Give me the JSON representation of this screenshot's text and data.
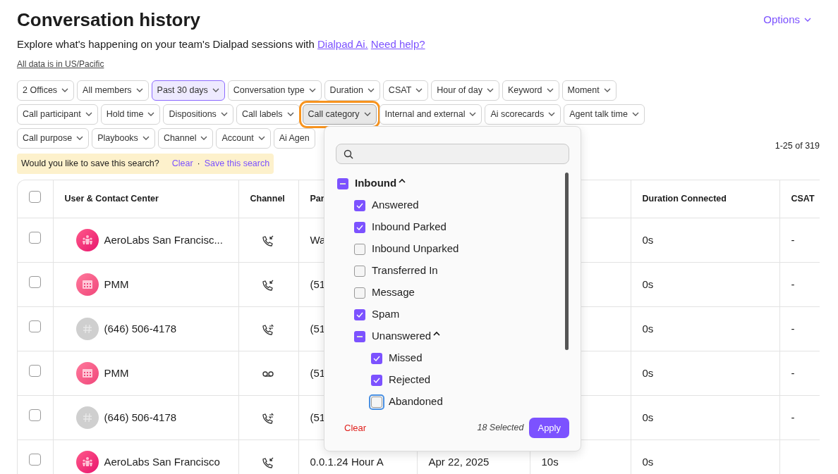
{
  "header": {
    "title": "Conversation history",
    "subtitle": "Explore what's happening on your team's Dialpad sessions with",
    "links": [
      "Dialpad Ai.",
      "Need help?"
    ],
    "timezone_note": "All data is in US/Pacific",
    "options": "Options"
  },
  "filter_rows": [
    [
      {
        "label": "2 Offices",
        "active": false,
        "open": false
      },
      {
        "label": "All members",
        "active": false,
        "open": false
      },
      {
        "label": "Past 30 days",
        "active": true,
        "open": false
      },
      {
        "label": "Conversation type",
        "active": false,
        "open": false
      },
      {
        "label": "Duration",
        "active": false,
        "open": false
      },
      {
        "label": "CSAT",
        "active": false,
        "open": false
      },
      {
        "label": "Hour of day",
        "active": false,
        "open": false
      },
      {
        "label": "Keyword",
        "active": false,
        "open": false
      },
      {
        "label": "Moment",
        "active": false,
        "open": false
      }
    ],
    [
      {
        "label": "Call participant",
        "active": false,
        "open": false
      },
      {
        "label": "Hold time",
        "active": false,
        "open": false
      },
      {
        "label": "Dispositions",
        "active": false,
        "open": false
      },
      {
        "label": "Call labels",
        "active": false,
        "open": false
      },
      {
        "label": "Call category",
        "active": false,
        "open": true
      },
      {
        "label": "Internal and external",
        "active": false,
        "open": false
      },
      {
        "label": "Ai scorecards",
        "active": false,
        "open": false
      },
      {
        "label": "Agent talk time",
        "active": false,
        "open": false
      }
    ],
    [
      {
        "label": "Call purpose",
        "active": false,
        "open": false
      },
      {
        "label": "Playbooks",
        "active": false,
        "open": false
      },
      {
        "label": "Channel",
        "active": false,
        "open": false
      },
      {
        "label": "Account",
        "active": false,
        "open": false
      },
      {
        "label": "Ai Agen",
        "active": false,
        "open": false
      }
    ]
  ],
  "save_prompt": {
    "text": "Would you like to save this search?",
    "actions": [
      "Clear",
      "Save this search"
    ],
    "separator": "·"
  },
  "pagination": "1-25 of 319",
  "table": {
    "select_all": {
      "checked": false
    },
    "columns": [
      "User & Contact Center",
      "Channel",
      "Par",
      "Duration Connected",
      "CSAT"
    ],
    "rows": [
      {
        "checked": false,
        "avatar": {
          "kind": "group"
        },
        "name": "AeroLabs San Francisc...",
        "channel": {
          "kind": "incoming"
        },
        "column_3": "Wa",
        "duration_connected": "0s",
        "csat": "-"
      },
      {
        "checked": false,
        "avatar": {
          "kind": "calendar"
        },
        "name": "PMM",
        "channel": {
          "kind": "incoming"
        },
        "column_3": "(51",
        "duration_connected": "0s",
        "csat": "-"
      },
      {
        "checked": false,
        "avatar": {
          "kind": "number"
        },
        "name": "(646) 506-4178",
        "channel": {
          "kind": "transfer"
        },
        "column_3": "(51",
        "duration_connected": "0s",
        "csat": "-"
      },
      {
        "checked": false,
        "avatar": {
          "kind": "calendar"
        },
        "name": "PMM",
        "channel": {
          "kind": "voicemail"
        },
        "column_3": "(51",
        "duration_connected": "0s",
        "csat": "-"
      },
      {
        "checked": false,
        "avatar": {
          "kind": "number"
        },
        "name": "(646) 506-4178",
        "channel": {
          "kind": "transfer"
        },
        "column_3": "(51",
        "duration_connected": "0s",
        "csat": "-"
      },
      {
        "checked": false,
        "avatar": {
          "kind": "group"
        },
        "name": "AeroLabs San Francisco",
        "channel": {
          "kind": "incoming"
        },
        "column_3": "0.0.1.24 Hour A",
        "column_4": "Apr 22, 2025",
        "column_5": "10s",
        "duration_connected": "0s"
      }
    ]
  },
  "dropdown": {
    "items": [
      {
        "label": "Inbound",
        "checked": true,
        "partial": true,
        "expanded": true,
        "children": [
          {
            "label": "Answered",
            "checked": true
          },
          {
            "label": "Inbound Parked",
            "checked": true
          },
          {
            "label": "Inbound Unparked",
            "checked": false
          },
          {
            "label": "Transferred In",
            "checked": false
          },
          {
            "label": "Message",
            "checked": false
          },
          {
            "label": "Spam",
            "checked": true
          },
          {
            "label": "Unanswered",
            "checked": true,
            "partial": true,
            "expanded": true,
            "children": [
              {
                "label": "Missed",
                "checked": true
              },
              {
                "label": "Rejected",
                "checked": true
              },
              {
                "label": "Abandoned",
                "checked": false,
                "focused": true
              }
            ]
          }
        ]
      }
    ],
    "clear": "Clear",
    "selected_count": "18 Selected",
    "apply": "Apply"
  }
}
